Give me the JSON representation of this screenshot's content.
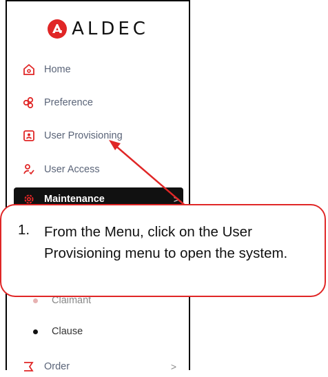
{
  "brand": {
    "name": "ALDEC",
    "color": "#e02626"
  },
  "sidebar": {
    "items": [
      {
        "label": "Home",
        "icon": "home-icon"
      },
      {
        "label": "Preference",
        "icon": "preference-icon"
      },
      {
        "label": "User Provisioning",
        "icon": "user-provisioning-icon"
      },
      {
        "label": "User Access",
        "icon": "user-access-icon"
      },
      {
        "label": "Maintenance",
        "icon": "settings-icon",
        "active": true
      },
      {
        "label": "Order",
        "icon": "order-icon"
      }
    ],
    "sub_items": [
      {
        "label": "Claimant"
      },
      {
        "label": "Clause"
      }
    ],
    "chevron": ">"
  },
  "callout": {
    "number": "1.",
    "text": "From the Menu, click on the User Provisioning menu to open the system.",
    "border_color": "#e02626"
  }
}
